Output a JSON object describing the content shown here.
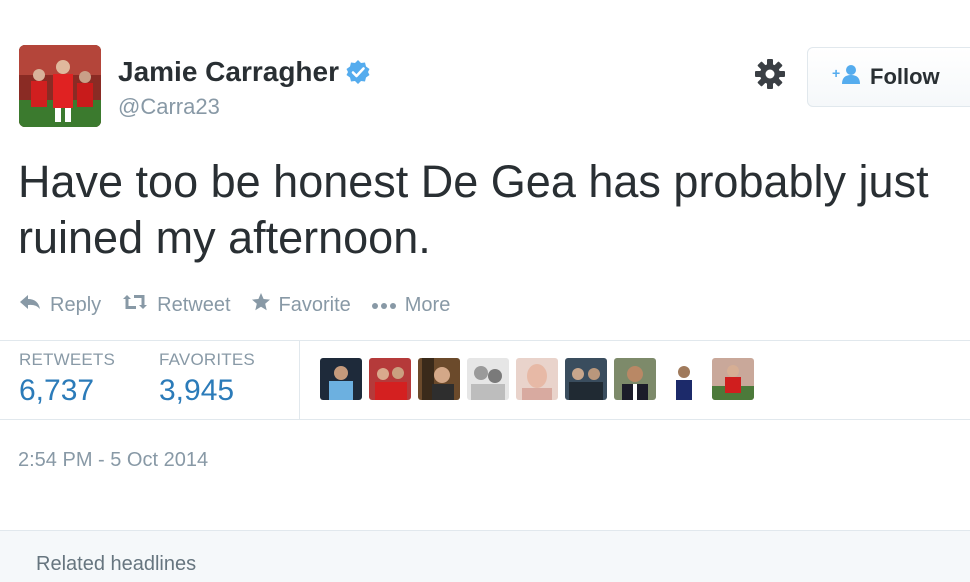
{
  "user": {
    "name": "Jamie Carragher",
    "handle": "@Carra23",
    "verified": true
  },
  "follow_label": "Follow",
  "tweet_text": "Have too be honest De Gea has probably just ruined my afternoon.",
  "actions": {
    "reply": "Reply",
    "retweet": "Retweet",
    "favorite": "Favorite",
    "more": "More"
  },
  "stats": {
    "retweets_label": "RETWEETS",
    "retweets_count": "6,737",
    "favorites_label": "FAVORITES",
    "favorites_count": "3,945"
  },
  "timestamp": "2:54 PM - 5 Oct 2014",
  "related_headlines": "Related headlines",
  "colors": {
    "link": "#2b7bb9",
    "muted": "#8899a6",
    "verified": "#55acee",
    "text": "#292f33"
  }
}
